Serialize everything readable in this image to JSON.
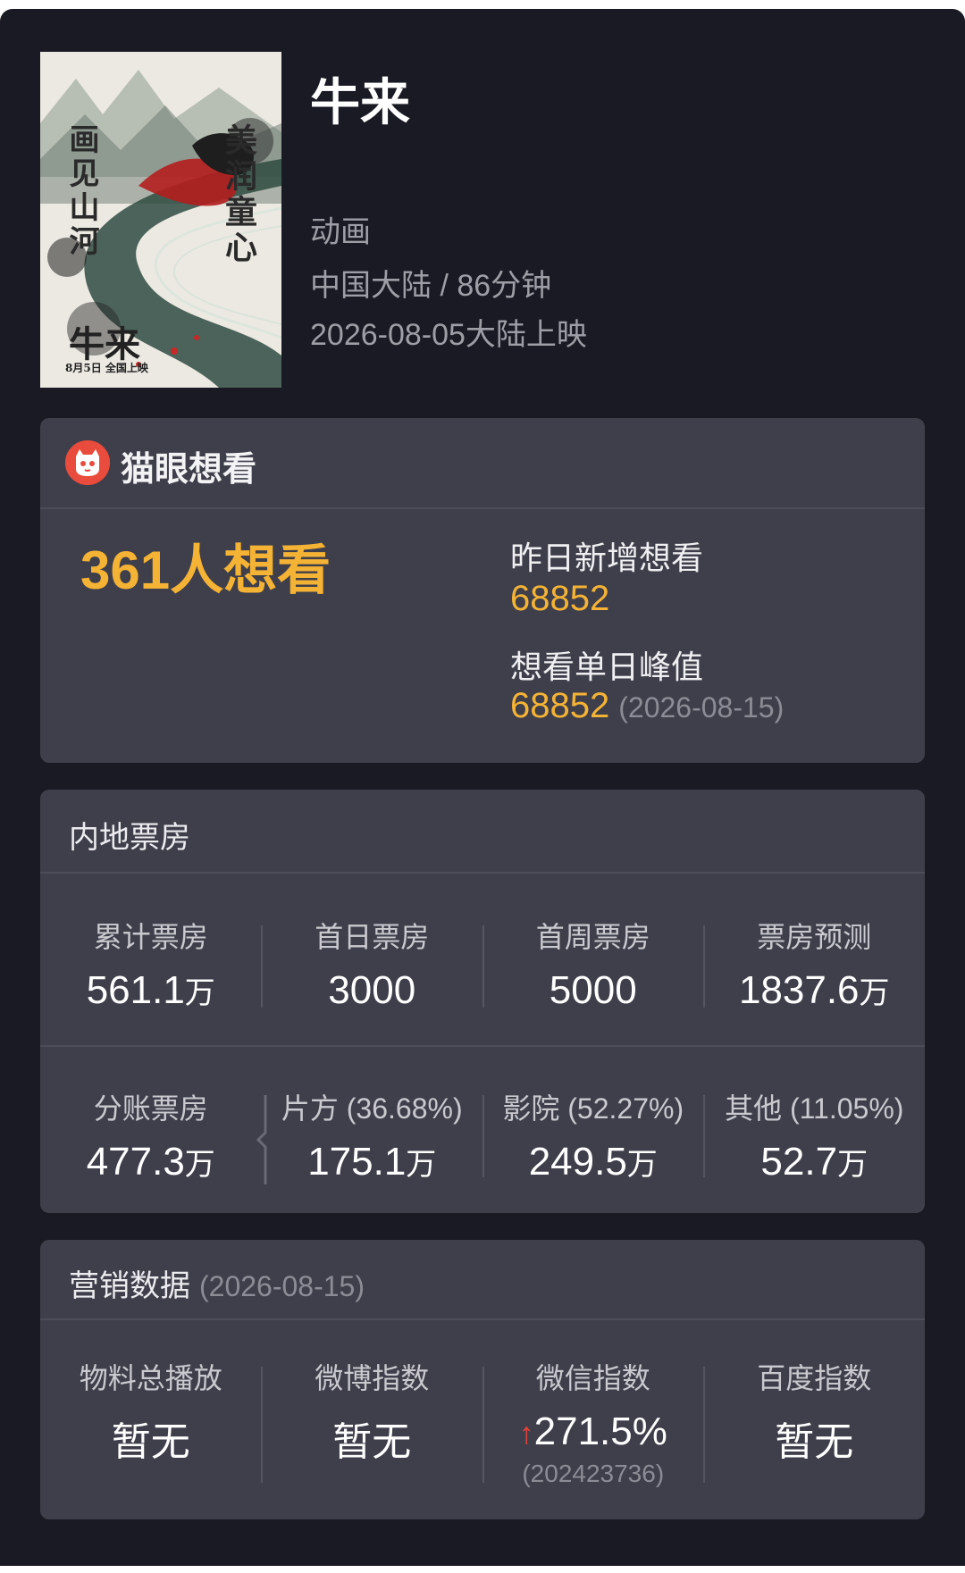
{
  "movie": {
    "title": "牛来",
    "genre": "动画",
    "region_duration": "中国大陆 / 86分钟",
    "release": "2026-08-05大陆上映",
    "poster": {
      "left_slogan": "画见山河",
      "right_slogan": "美润童心",
      "title": "牛来",
      "date": "8月5日 全国上映"
    }
  },
  "maoyan": {
    "brand": "猫眼想看",
    "want_total": "361人想看",
    "yesterday_label": "昨日新增想看",
    "yesterday_value": "68852",
    "peak_label": "想看单日峰值",
    "peak_value": "68852",
    "peak_date": "(2026-08-15)"
  },
  "box_office": {
    "header": "内地票房",
    "row1": [
      {
        "label": "累计票房",
        "value": "561.1",
        "unit": "万"
      },
      {
        "label": "首日票房",
        "value": "3000",
        "unit": ""
      },
      {
        "label": "首周票房",
        "value": "5000",
        "unit": ""
      },
      {
        "label": "票房预测",
        "value": "1837.6",
        "unit": "万"
      }
    ],
    "row2": [
      {
        "label": "分账票房",
        "value": "477.3",
        "unit": "万"
      },
      {
        "label": "片方 (36.68%)",
        "value": "175.1",
        "unit": "万"
      },
      {
        "label": "影院 (52.27%)",
        "value": "249.5",
        "unit": "万"
      },
      {
        "label": "其他 (11.05%)",
        "value": "52.7",
        "unit": "万"
      }
    ]
  },
  "marketing": {
    "header": "营销数据",
    "date": "(2026-08-15)",
    "items": [
      {
        "label": "物料总播放",
        "value": "暂无",
        "sub": ""
      },
      {
        "label": "微博指数",
        "value": "暂无",
        "sub": ""
      },
      {
        "label": "微信指数",
        "value": "271.5%",
        "sub": "(202423736)",
        "trend": "up"
      },
      {
        "label": "百度指数",
        "value": "暂无",
        "sub": ""
      }
    ]
  },
  "colors": {
    "background": "#1a1a24",
    "card": "#3f3f4b",
    "accent": "#f5b335",
    "trend_up": "#e8423a",
    "maoyan_red": "#e94b3c"
  }
}
